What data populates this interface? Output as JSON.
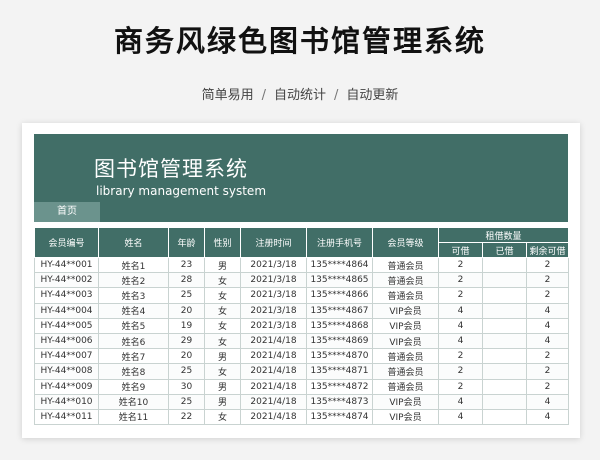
{
  "header": {
    "title": "商务风绿色图书馆管理系统",
    "subtitle_items": [
      "简单易用",
      "自动统计",
      "自动更新"
    ],
    "separator": "/"
  },
  "banner": {
    "title": "图书馆管理系统",
    "subtitle": "library management system",
    "home_tab": "首页"
  },
  "colors": {
    "accent": "#416e67",
    "tab": "#6b938d",
    "background": "#f3f3f3"
  },
  "table": {
    "columns": [
      "会员编号",
      "姓名",
      "年龄",
      "性别",
      "注册时间",
      "注册手机号",
      "会员等级"
    ],
    "group_header": "租借数量",
    "sub_columns": [
      "可借",
      "已借",
      "剩余可借"
    ],
    "rows": [
      [
        "HY-44**001",
        "姓名1",
        "23",
        "男",
        "2021/3/18",
        "135****4864",
        "普通会员",
        "2",
        "",
        "2"
      ],
      [
        "HY-44**002",
        "姓名2",
        "28",
        "女",
        "2021/3/18",
        "135****4865",
        "普通会员",
        "2",
        "",
        "2"
      ],
      [
        "HY-44**003",
        "姓名3",
        "25",
        "女",
        "2021/3/18",
        "135****4866",
        "普通会员",
        "2",
        "",
        "2"
      ],
      [
        "HY-44**004",
        "姓名4",
        "20",
        "女",
        "2021/3/18",
        "135****4867",
        "VIP会员",
        "4",
        "",
        "4"
      ],
      [
        "HY-44**005",
        "姓名5",
        "19",
        "女",
        "2021/3/18",
        "135****4868",
        "VIP会员",
        "4",
        "",
        "4"
      ],
      [
        "HY-44**006",
        "姓名6",
        "29",
        "女",
        "2021/4/18",
        "135****4869",
        "VIP会员",
        "4",
        "",
        "4"
      ],
      [
        "HY-44**007",
        "姓名7",
        "20",
        "男",
        "2021/4/18",
        "135****4870",
        "普通会员",
        "2",
        "",
        "2"
      ],
      [
        "HY-44**008",
        "姓名8",
        "25",
        "女",
        "2021/4/18",
        "135****4871",
        "普通会员",
        "2",
        "",
        "2"
      ],
      [
        "HY-44**009",
        "姓名9",
        "30",
        "男",
        "2021/4/18",
        "135****4872",
        "普通会员",
        "2",
        "",
        "2"
      ],
      [
        "HY-44**010",
        "姓名10",
        "25",
        "男",
        "2021/4/18",
        "135****4873",
        "VIP会员",
        "4",
        "",
        "4"
      ],
      [
        "HY-44**011",
        "姓名11",
        "22",
        "女",
        "2021/4/18",
        "135****4874",
        "VIP会员",
        "4",
        "",
        "4"
      ]
    ]
  }
}
